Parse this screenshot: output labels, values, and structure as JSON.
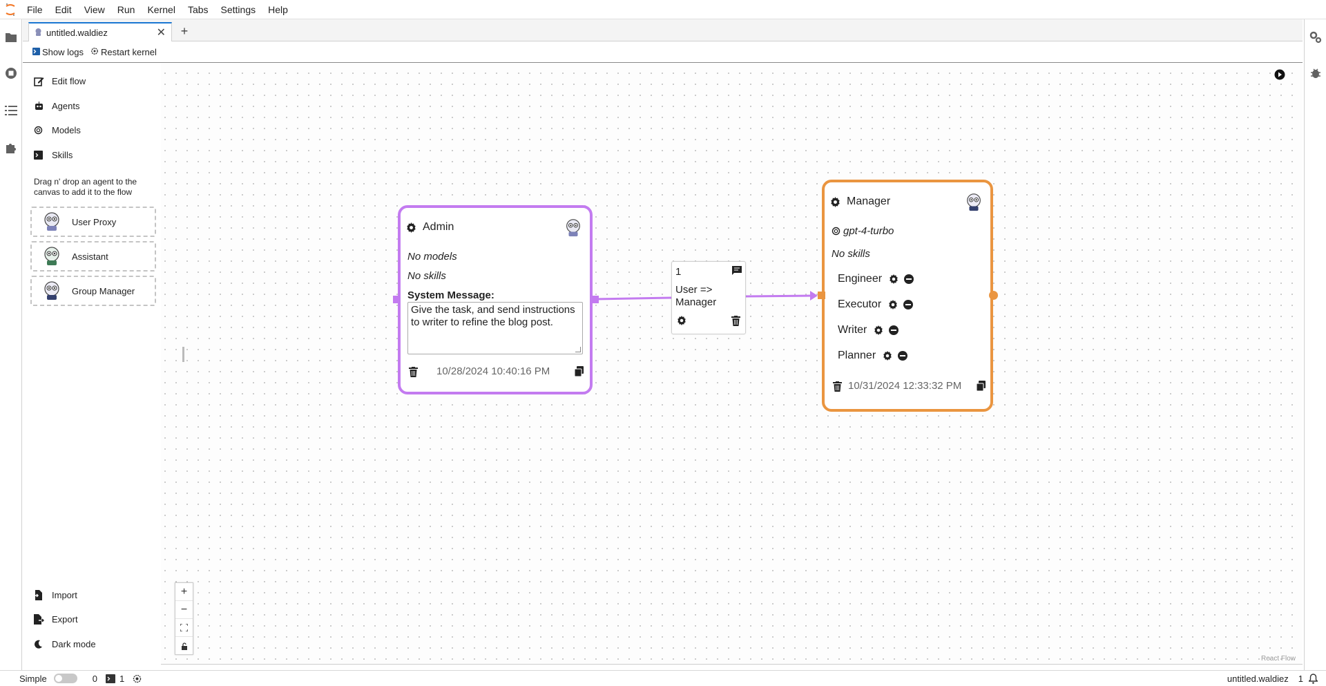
{
  "menubar": {
    "items": [
      "File",
      "Edit",
      "View",
      "Run",
      "Kernel",
      "Tabs",
      "Settings",
      "Help"
    ]
  },
  "tabs": [
    {
      "label": "untitled.waldiez",
      "icon": "waldiez-file-icon"
    }
  ],
  "toolbar": {
    "show_logs": "Show logs",
    "restart_kernel": "Restart kernel"
  },
  "sidebar": {
    "items": [
      {
        "label": "Edit flow",
        "icon": "edit-icon"
      },
      {
        "label": "Agents",
        "icon": "robot-icon"
      },
      {
        "label": "Models",
        "icon": "openai-icon"
      },
      {
        "label": "Skills",
        "icon": "terminal-icon"
      }
    ],
    "hint": "Drag n' drop an agent to the canvas to add it to the flow",
    "agent_types": [
      {
        "label": "User Proxy"
      },
      {
        "label": "Assistant"
      },
      {
        "label": "Group Manager"
      }
    ],
    "bottom": [
      {
        "label": "Import",
        "icon": "import-icon"
      },
      {
        "label": "Export",
        "icon": "export-icon"
      },
      {
        "label": "Dark mode",
        "icon": "moon-icon"
      }
    ]
  },
  "nodes": {
    "admin": {
      "title": "Admin",
      "models": "No models",
      "skills": "No skills",
      "system_message_label": "System Message:",
      "system_message": "Give the task, and send instructions to writer to refine the blog post.",
      "timestamp": "10/28/2024 10:40:16 PM",
      "border_color": "#c37bf0"
    },
    "manager": {
      "title": "Manager",
      "model": "gpt-4-turbo",
      "skills": "No skills",
      "members": [
        "Engineer",
        "Executor",
        "Writer",
        "Planner"
      ],
      "timestamp": "10/31/2024 12:33:32 PM",
      "border_color": "#ea9540"
    }
  },
  "edge": {
    "order": "1",
    "label": "User => Manager",
    "color": "#c37bf0"
  },
  "canvas": {
    "attribution": "React Flow"
  },
  "statusbar": {
    "mode": "Simple",
    "count_a": "0",
    "count_b": "1",
    "filename": "untitled.waldiez",
    "notifications": "1"
  }
}
